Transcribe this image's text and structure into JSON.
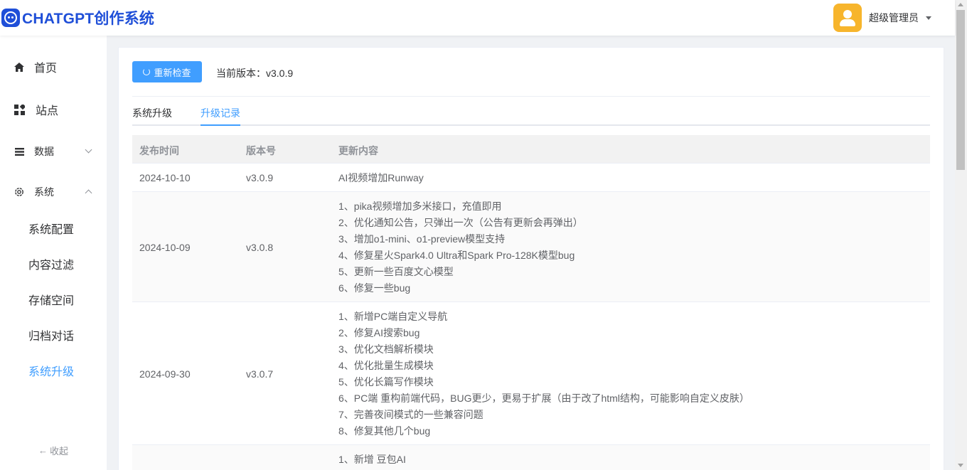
{
  "header": {
    "logo_text": "CHATGPT创作系统",
    "user_name": "超级管理员"
  },
  "sidebar": {
    "items": [
      {
        "label": "首页",
        "icon": "home-icon"
      },
      {
        "label": "站点",
        "icon": "grid-icon"
      },
      {
        "label": "数据",
        "icon": "list-icon"
      },
      {
        "label": "系统",
        "icon": "gear-icon"
      }
    ],
    "sub_items": [
      {
        "label": "系统配置"
      },
      {
        "label": "内容过滤"
      },
      {
        "label": "存储空间"
      },
      {
        "label": "归档对话"
      },
      {
        "label": "系统升级",
        "active": true
      }
    ],
    "collapse_label": "收起"
  },
  "toolbar": {
    "recheck_label": "重新检查",
    "version_text": "当前版本：v3.0.9"
  },
  "tabs": [
    {
      "label": "系统升级"
    },
    {
      "label": "升级记录",
      "active": true
    }
  ],
  "table": {
    "headers": [
      "发布时间",
      "版本号",
      "更新内容"
    ],
    "rows": [
      {
        "date": "2024-10-10",
        "version": "v3.0.9",
        "lines": [
          "AI视频增加Runway"
        ]
      },
      {
        "date": "2024-10-09",
        "version": "v3.0.8",
        "lines": [
          "1、pika视频增加多米接口，充值即用",
          "2、优化通知公告，只弹出一次（公告有更新会再弹出）",
          "3、增加o1-mini、o1-preview模型支持",
          "4、修复星火Spark4.0 Ultra和Spark Pro-128K模型bug",
          "5、更新一些百度文心模型",
          "6、修复一些bug"
        ]
      },
      {
        "date": "2024-09-30",
        "version": "v3.0.7",
        "lines": [
          "1、新增PC端自定义导航",
          "2、修复AI搜索bug",
          "3、优化文档解析模块",
          "4、优化批量生成模块",
          "5、优化长篇写作模块",
          "6、PC端 重构前端代码，BUG更少，更易于扩展（由于改了html结构，可能影响自定义皮肤）",
          "7、完善夜间模式的一些兼容问题",
          "8、修复其他几个bug"
        ]
      },
      {
        "date": "",
        "version": "",
        "lines": [
          "1、新增 豆包AI"
        ]
      }
    ]
  },
  "colors": {
    "accent": "#409eff",
    "brand": "#1f4fd8",
    "avatar_bg": "#f7b52c"
  }
}
